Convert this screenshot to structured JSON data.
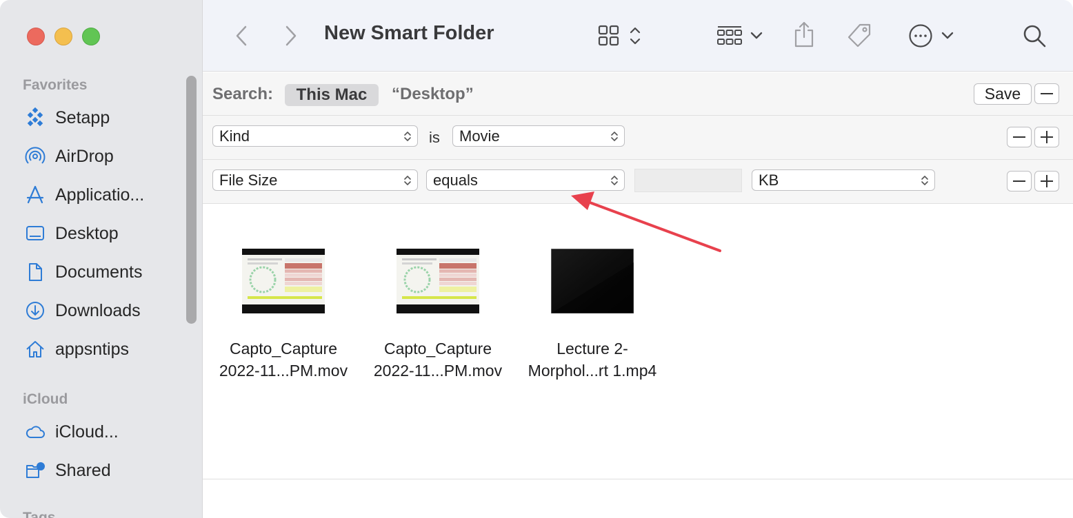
{
  "window": {
    "title": "New Smart Folder"
  },
  "sidebar": {
    "sections": [
      {
        "label": "Favorites"
      },
      {
        "label": "iCloud"
      },
      {
        "label": "Tags"
      }
    ],
    "favorites": [
      {
        "label": "Setapp",
        "icon": "setapp-icon"
      },
      {
        "label": "AirDrop",
        "icon": "airdrop-icon"
      },
      {
        "label": "Applicatio...",
        "icon": "applications-icon"
      },
      {
        "label": "Desktop",
        "icon": "desktop-icon"
      },
      {
        "label": "Documents",
        "icon": "document-icon"
      },
      {
        "label": "Downloads",
        "icon": "download-icon"
      },
      {
        "label": "appsntips",
        "icon": "home-icon"
      }
    ],
    "icloud": [
      {
        "label": "iCloud...",
        "icon": "cloud-icon"
      },
      {
        "label": "Shared",
        "icon": "shared-folder-icon"
      }
    ]
  },
  "search": {
    "label": "Search:",
    "scope_active": "This Mac",
    "scope_other": "“Desktop”",
    "save_label": "Save"
  },
  "criteria": [
    {
      "attribute": "Kind",
      "operator_text": "is",
      "value": "Movie"
    },
    {
      "attribute": "File Size",
      "operator": "equals",
      "value": "",
      "unit": "KB"
    }
  ],
  "files": [
    {
      "line1": "Capto_Capture",
      "line2": "2022-11...PM.mov"
    },
    {
      "line1": "Capto_Capture",
      "line2": "2022-11...PM.mov"
    },
    {
      "line1": "Lecture 2-",
      "line2": "Morphol...rt 1.mp4"
    }
  ],
  "colors": {
    "accent": "#2e7cd6",
    "annotation_arrow": "#e8414d"
  }
}
